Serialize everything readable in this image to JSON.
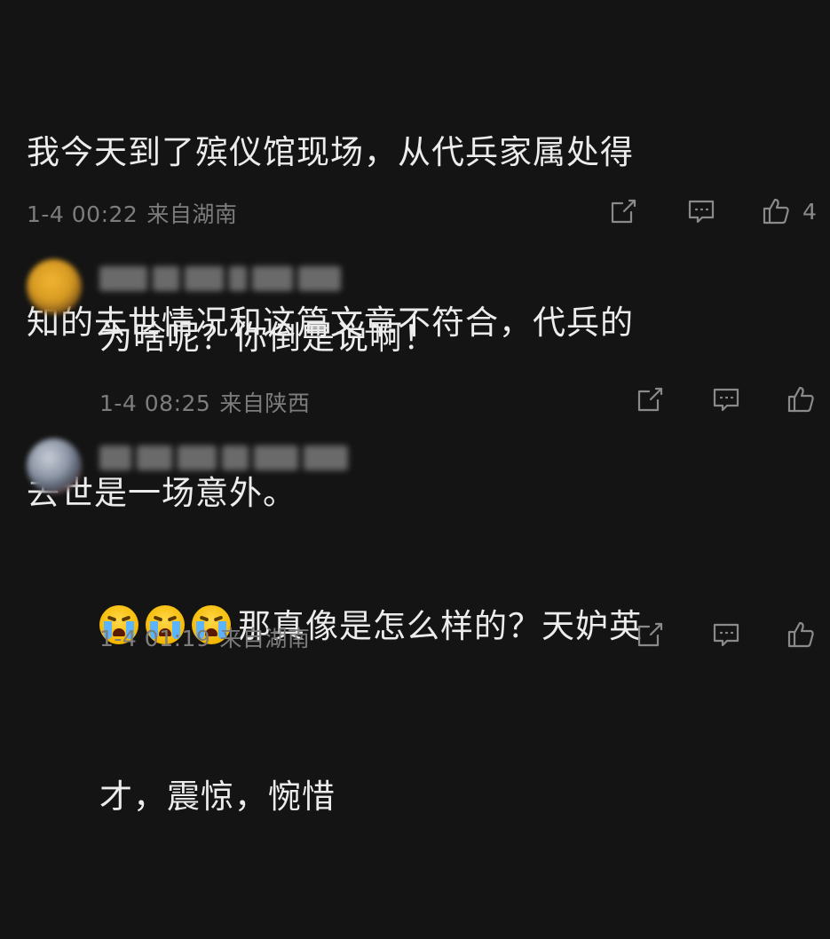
{
  "comments": [
    {
      "text": "我今天到了殡仪馆现场，从代兵家属处得知的去世情况和这篇文章不符合，代兵的去世是一场意外。",
      "lines": [
        "我今天到了殡仪馆现场，从代兵家属处得",
        "知的去世情况和这篇文章不符合，代兵的",
        "去世是一场意外。"
      ],
      "date": "1-4 00:22",
      "location": "来自湖南",
      "like_count": "4"
    },
    {
      "text": "为啥呢？你倒是说啊！",
      "date": "1-4 08:25",
      "location": "来自陕西",
      "like_count": ""
    },
    {
      "emoji_name": "crying-face-emoji",
      "lines": [
        "那真像是怎么样的？天妒英",
        "才，震惊，惋惜"
      ],
      "date": "1-4 01:19",
      "location": "来自湖南",
      "like_count": ""
    }
  ],
  "icons": {
    "share": "share-icon",
    "reply": "comment-icon",
    "like": "thumbs-up-icon"
  },
  "colors": {
    "background": "#141414",
    "text": "#ececec",
    "meta": "#7d7d7d",
    "icon": "#8a8a8a"
  }
}
